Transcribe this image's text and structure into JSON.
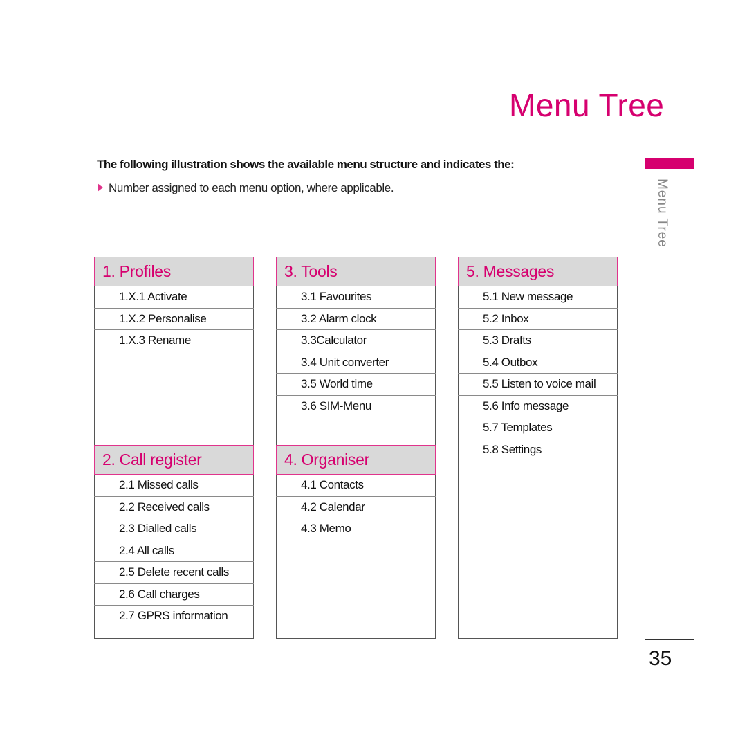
{
  "page": {
    "title": "Menu Tree",
    "intro": "The following illustration shows the available menu structure and indicates the:",
    "bullet": "Number assigned to each menu option, where applicable.",
    "side_label": "Menu Tree",
    "page_number": "35",
    "accent_color": "#d6006f"
  },
  "menus": [
    {
      "heading": "1. Profiles",
      "items": [
        "1.X.1 Activate",
        "1.X.2 Personalise",
        "1.X.3 Rename"
      ]
    },
    {
      "heading": "2. Call register",
      "items": [
        "2.1 Missed calls",
        "2.2 Received calls",
        "2.3 Dialled calls",
        "2.4 All calls",
        "2.5 Delete recent calls",
        "2.6 Call charges",
        "2.7 GPRS information"
      ]
    },
    {
      "heading": "3. Tools",
      "items": [
        "3.1 Favourites",
        "3.2 Alarm clock",
        "3.3Calculator",
        "3.4 Unit converter",
        "3.5 World time",
        "3.6 SIM-Menu"
      ]
    },
    {
      "heading": "4. Organiser",
      "items": [
        "4.1 Contacts",
        "4.2 Calendar",
        "4.3 Memo"
      ]
    },
    {
      "heading": "5. Messages",
      "items": [
        "5.1 New message",
        "5.2 Inbox",
        "5.3 Drafts",
        "5.4 Outbox",
        "5.5 Listen to voice mail",
        "5.6 Info message",
        "5.7 Templates",
        "5.8 Settings"
      ]
    }
  ]
}
